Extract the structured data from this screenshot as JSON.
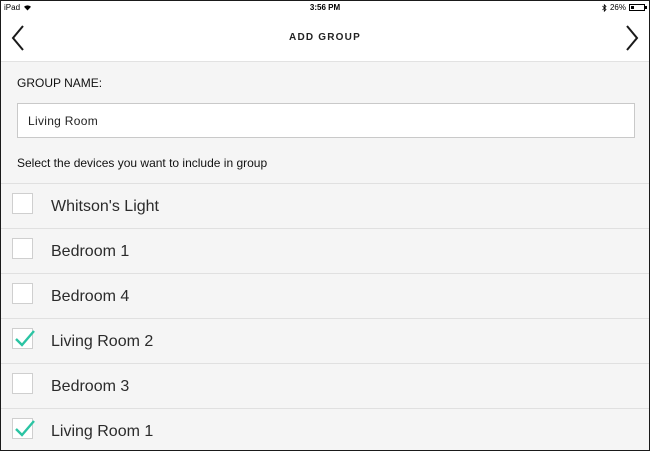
{
  "status_bar": {
    "device": "iPad",
    "time": "3:56 PM",
    "battery": "26%",
    "battery_level": 0.26
  },
  "nav": {
    "title": "ADD GROUP",
    "back_icon": "chevron-left",
    "forward_icon": "chevron-right"
  },
  "form": {
    "group_name_label": "GROUP NAME:",
    "group_name_value": "Living Room",
    "instructions": "Select the devices you want to include in group"
  },
  "devices": [
    {
      "label": "Whitson's Light",
      "checked": false
    },
    {
      "label": "Bedroom 1",
      "checked": false
    },
    {
      "label": "Bedroom 4",
      "checked": false
    },
    {
      "label": "Living Room 2",
      "checked": true
    },
    {
      "label": "Bedroom 3",
      "checked": false
    },
    {
      "label": "Living Room 1",
      "checked": true
    }
  ],
  "colors": {
    "check": "#2bc4a3",
    "background": "#f5f5f5",
    "header": "#ffffff"
  }
}
